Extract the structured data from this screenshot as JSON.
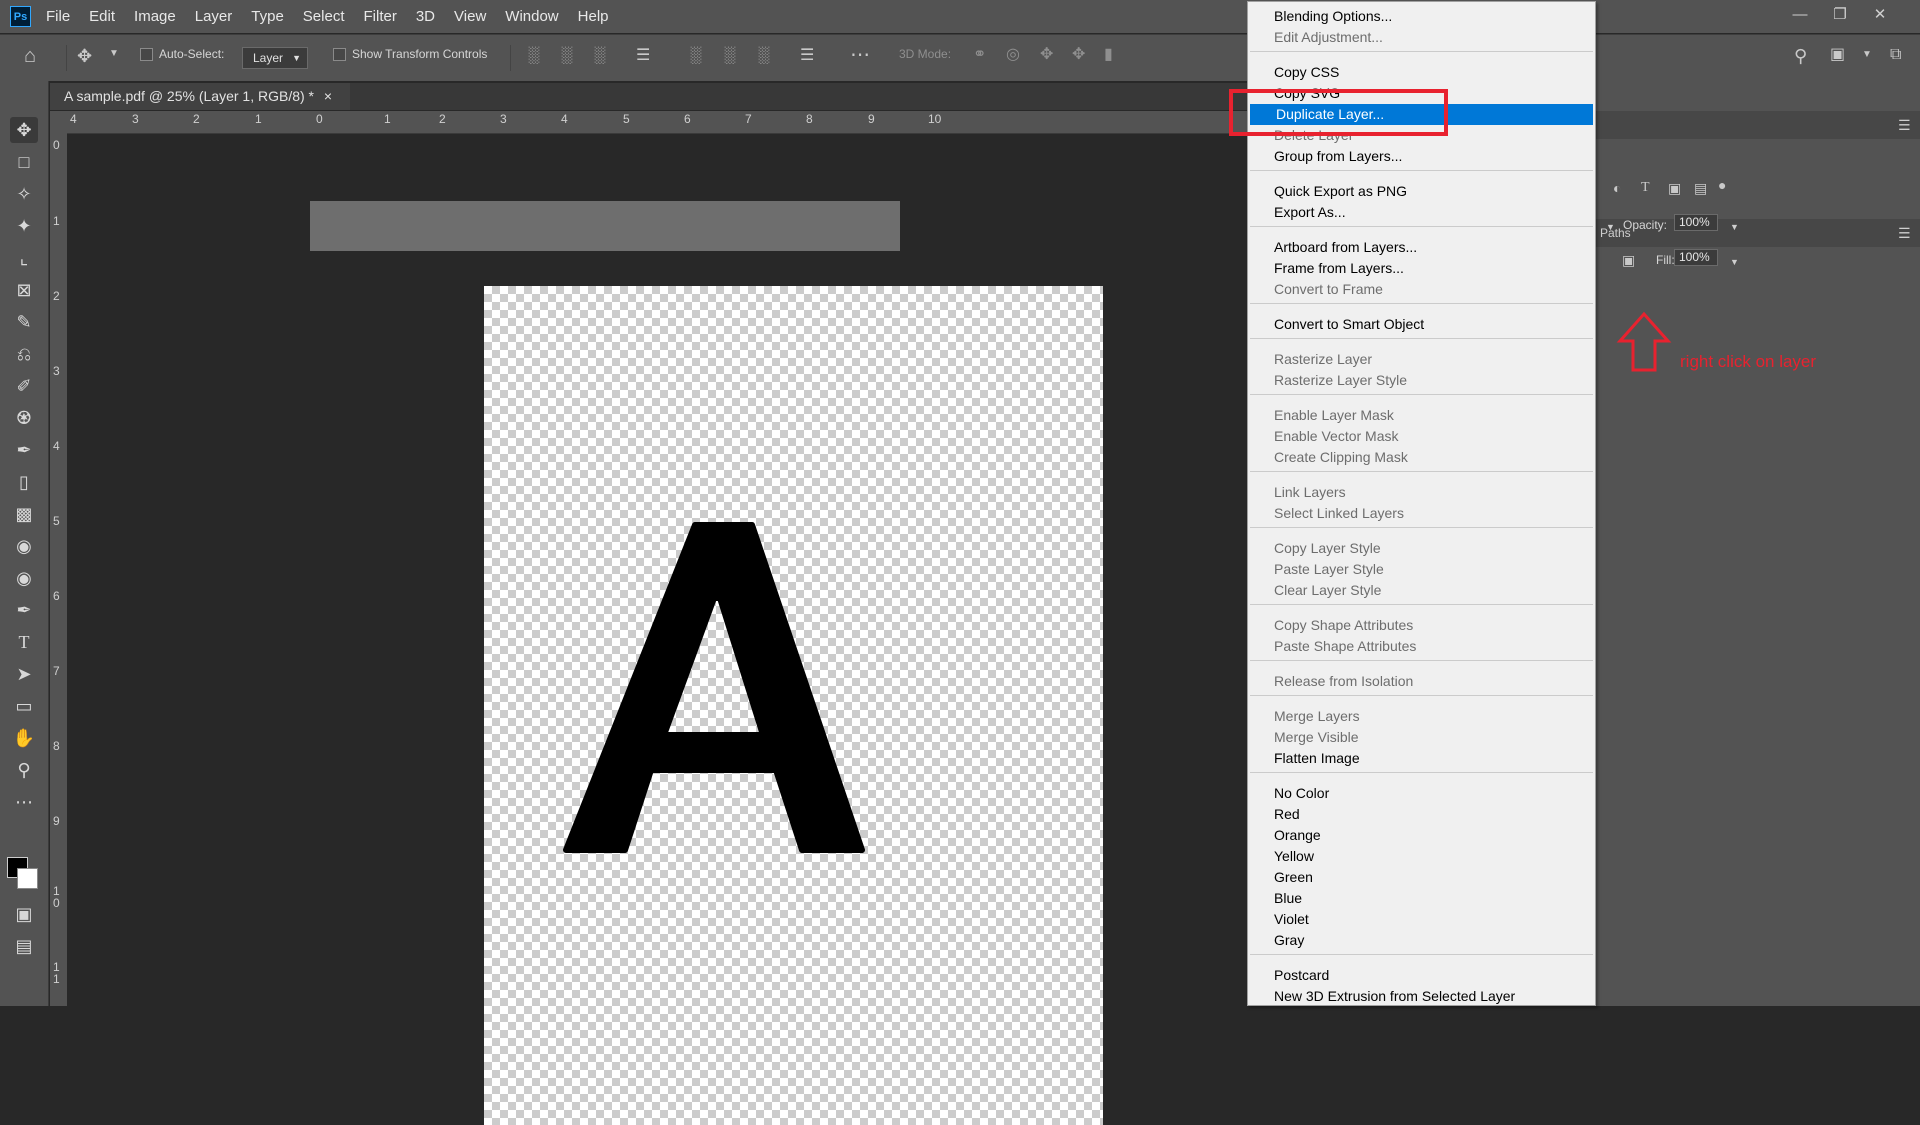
{
  "app": {
    "logo_text": "Ps"
  },
  "menubar": {
    "items": [
      "File",
      "Edit",
      "Image",
      "Layer",
      "Type",
      "Select",
      "Filter",
      "3D",
      "View",
      "Window",
      "Help"
    ]
  },
  "options_bar": {
    "auto_select_label": "Auto-Select:",
    "auto_select_value": "Layer",
    "show_transform_label": "Show Transform Controls",
    "mode_3d_label": "3D Mode:"
  },
  "document": {
    "tab_title": "A sample.pdf @ 25% (Layer 1, RGB/8) *",
    "close_glyph": "×",
    "glyph_letter": "A"
  },
  "rulers": {
    "horizontal": [
      "4",
      "3",
      "2",
      "1",
      "0",
      "1",
      "2",
      "3",
      "4",
      "5",
      "6",
      "7",
      "8",
      "9",
      "10"
    ],
    "vertical": [
      "0",
      "1",
      "2",
      "3",
      "4",
      "5",
      "6",
      "7",
      "8",
      "9",
      "1\n0",
      "1\n1"
    ]
  },
  "right_panel": {
    "tab_paths": "Paths",
    "opacity_label": "Opacity:",
    "opacity_value": "100%",
    "fill_label": "Fill:",
    "fill_value": "100%"
  },
  "context_menu": {
    "groups": [
      [
        {
          "label": "Blending Options...",
          "enabled": true
        },
        {
          "label": "Edit Adjustment...",
          "enabled": false
        }
      ],
      [
        {
          "label": "Copy CSS",
          "enabled": true
        },
        {
          "label": "Copy SVG",
          "enabled": true
        },
        {
          "label": "Duplicate Layer...",
          "enabled": true,
          "highlighted": true
        },
        {
          "label": "Delete Layer",
          "enabled": false
        },
        {
          "label": "Group from Layers...",
          "enabled": true
        }
      ],
      [
        {
          "label": "Quick Export as PNG",
          "enabled": true
        },
        {
          "label": "Export As...",
          "enabled": true
        }
      ],
      [
        {
          "label": "Artboard from Layers...",
          "enabled": true
        },
        {
          "label": "Frame from Layers...",
          "enabled": true
        },
        {
          "label": "Convert to Frame",
          "enabled": false
        }
      ],
      [
        {
          "label": "Convert to Smart Object",
          "enabled": true
        }
      ],
      [
        {
          "label": "Rasterize Layer",
          "enabled": false
        },
        {
          "label": "Rasterize Layer Style",
          "enabled": false
        }
      ],
      [
        {
          "label": "Enable Layer Mask",
          "enabled": false
        },
        {
          "label": "Enable Vector Mask",
          "enabled": false
        },
        {
          "label": "Create Clipping Mask",
          "enabled": false
        }
      ],
      [
        {
          "label": "Link Layers",
          "enabled": false
        },
        {
          "label": "Select Linked Layers",
          "enabled": false
        }
      ],
      [
        {
          "label": "Copy Layer Style",
          "enabled": false
        },
        {
          "label": "Paste Layer Style",
          "enabled": false
        },
        {
          "label": "Clear Layer Style",
          "enabled": false
        }
      ],
      [
        {
          "label": "Copy Shape Attributes",
          "enabled": false
        },
        {
          "label": "Paste Shape Attributes",
          "enabled": false
        }
      ],
      [
        {
          "label": "Release from Isolation",
          "enabled": false
        }
      ],
      [
        {
          "label": "Merge Layers",
          "enabled": false
        },
        {
          "label": "Merge Visible",
          "enabled": false
        },
        {
          "label": "Flatten Image",
          "enabled": true
        }
      ],
      [
        {
          "label": "No Color",
          "enabled": true
        },
        {
          "label": "Red",
          "enabled": true
        },
        {
          "label": "Orange",
          "enabled": true
        },
        {
          "label": "Yellow",
          "enabled": true
        },
        {
          "label": "Green",
          "enabled": true
        },
        {
          "label": "Blue",
          "enabled": true
        },
        {
          "label": "Violet",
          "enabled": true
        },
        {
          "label": "Gray",
          "enabled": true
        }
      ],
      [
        {
          "label": "Postcard",
          "enabled": true
        },
        {
          "label": "New 3D Extrusion from Selected Layer",
          "enabled": true
        }
      ]
    ]
  },
  "annotation": {
    "text": "right click on layer",
    "color": "#e8222f"
  },
  "colors": {
    "highlight": "#0078d7",
    "panel_bg": "#535353",
    "canvas_bg": "#282828"
  }
}
